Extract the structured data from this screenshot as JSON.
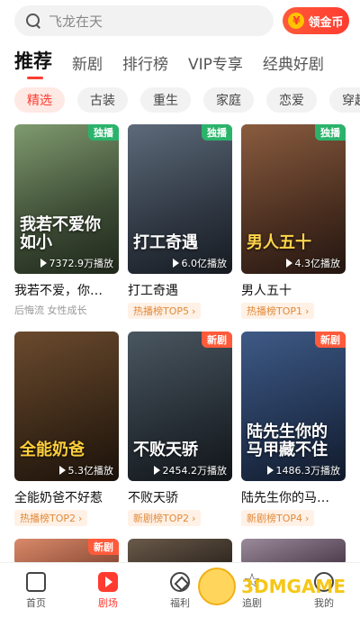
{
  "search": {
    "placeholder": "飞龙在天"
  },
  "coin_button": {
    "icon": "¥",
    "label": "领金币"
  },
  "tabs": [
    "推荐",
    "新剧",
    "排行榜",
    "VIP专享",
    "经典好剧"
  ],
  "chips": [
    "精选",
    "古装",
    "重生",
    "家庭",
    "恋爱",
    "穿越"
  ],
  "dramas": [
    {
      "poster_title": "我若不爱你如小",
      "badge": "独播",
      "plays": "7372.9万播放",
      "title": "我若不爱，你…",
      "sub": "后悔流 女性成长",
      "rank": ""
    },
    {
      "poster_title": "打工奇遇",
      "badge": "独播",
      "plays": "6.0亿播放",
      "title": "打工奇遇",
      "sub": "",
      "rank": "热播榜TOP5"
    },
    {
      "poster_title": "男人五十",
      "badge": "独播",
      "plays": "4.3亿播放",
      "title": "男人五十",
      "sub": "",
      "rank": "热播榜TOP1"
    },
    {
      "poster_title": "全能奶爸",
      "badge": "",
      "plays": "5.3亿播放",
      "title": "全能奶爸不好惹",
      "sub": "",
      "rank": "热播榜TOP2"
    },
    {
      "poster_title": "不败天骄",
      "badge": "新剧",
      "plays": "2454.2万播放",
      "title": "不败天骄",
      "sub": "",
      "rank": "新剧榜TOP2"
    },
    {
      "poster_title": "陆先生你的马甲藏不住",
      "badge": "新剧",
      "plays": "1486.3万播放",
      "title": "陆先生你的马…",
      "sub": "",
      "rank": "新剧榜TOP4"
    },
    {
      "poster_title": "",
      "badge": "新剧",
      "plays": "",
      "title": "",
      "sub": "",
      "rank": ""
    },
    {
      "poster_title": "",
      "badge": "",
      "plays": "",
      "title": "",
      "sub": "",
      "rank": ""
    },
    {
      "poster_title": "",
      "badge": "",
      "plays": "",
      "title": "",
      "sub": "",
      "rank": ""
    }
  ],
  "bottom_nav": [
    "首页",
    "剧场",
    "福利",
    "追剧",
    "我的"
  ],
  "watermark": "3DMGAME",
  "colors": {
    "accent": "#ff3b30",
    "exclusive_badge": "#2bb36b",
    "new_badge": "#ff5a3a"
  }
}
